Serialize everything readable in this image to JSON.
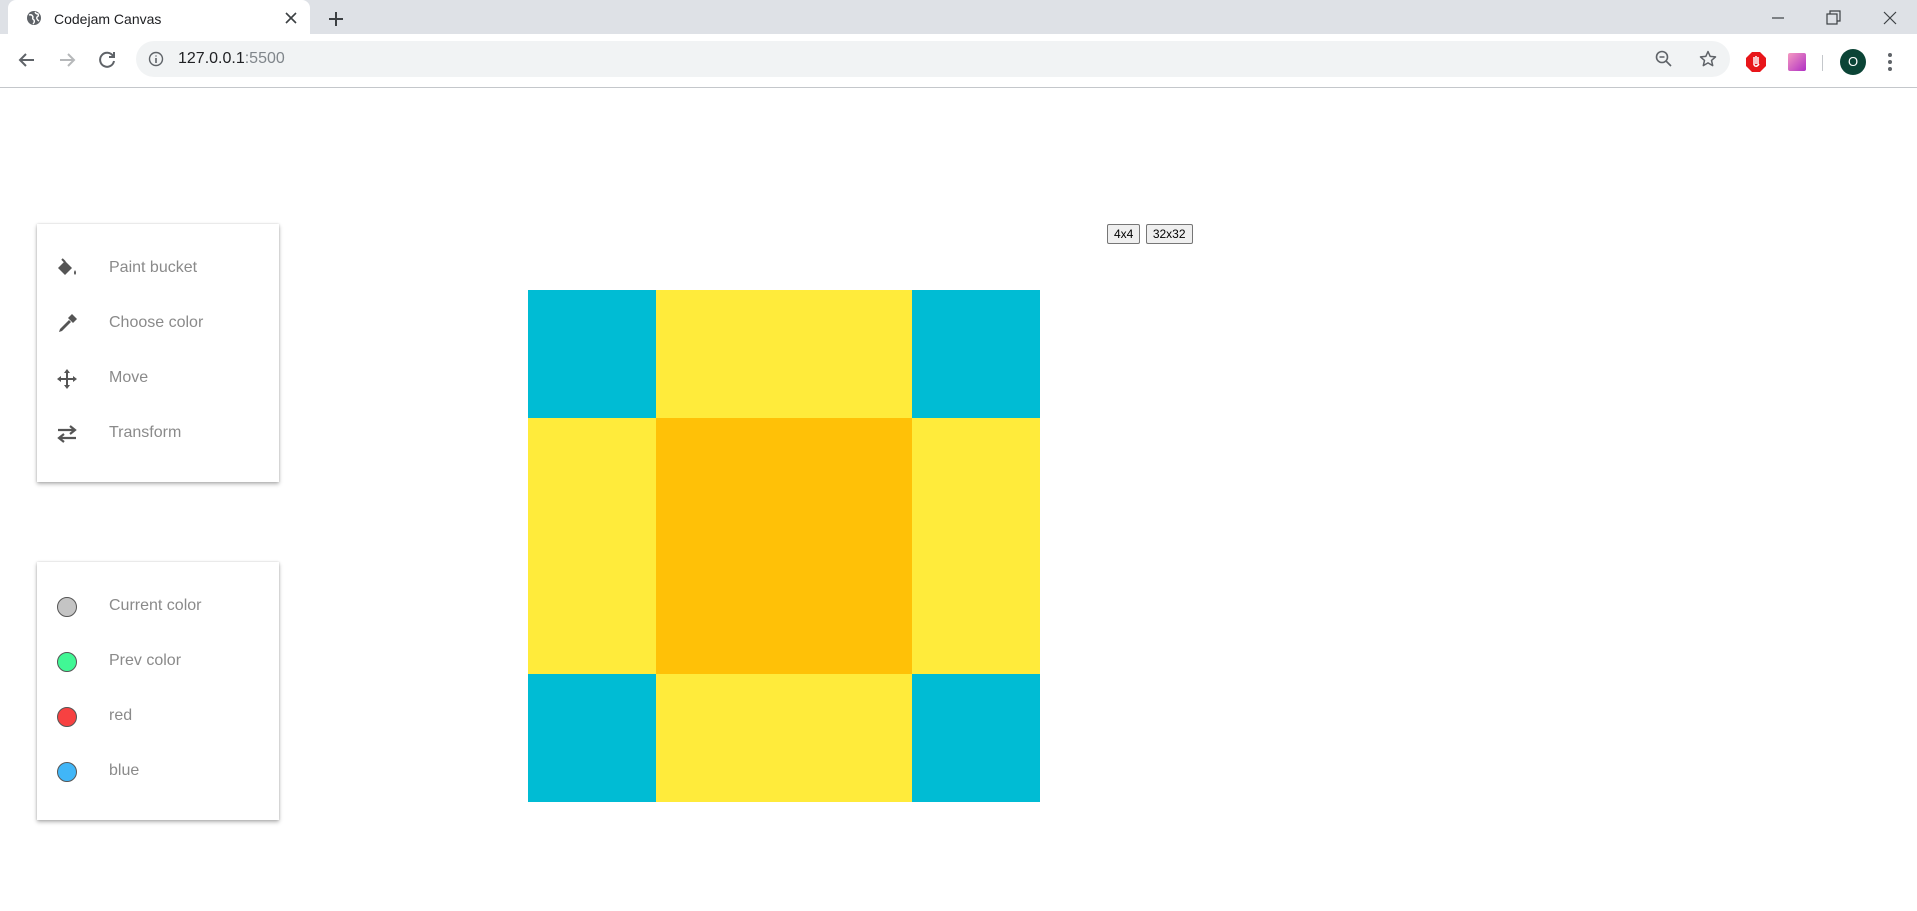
{
  "browser": {
    "tab_title": "Codejam Canvas",
    "url_host": "127.0.0.1",
    "url_port": ":5500",
    "profile_initial": "O"
  },
  "tools_panel": {
    "items": [
      {
        "label": "Paint bucket",
        "icon": "paint-bucket-icon"
      },
      {
        "label": "Choose color",
        "icon": "eyedropper-icon"
      },
      {
        "label": "Move",
        "icon": "move-icon"
      },
      {
        "label": "Transform",
        "icon": "swap-arrows-icon"
      }
    ]
  },
  "colors_panel": {
    "items": [
      {
        "label": "Current color",
        "color": "#c4c4c4"
      },
      {
        "label": "Prev color",
        "color": "#41f795"
      },
      {
        "label": "red",
        "color": "#f74141"
      },
      {
        "label": "blue",
        "color": "#41b6f7"
      }
    ]
  },
  "size_buttons": [
    "4x4",
    "32x32"
  ],
  "canvas": {
    "grid": 4,
    "colors": [
      [
        "#00bcd4",
        "#ffeb3b",
        "#ffeb3b",
        "#00bcd4"
      ],
      [
        "#ffeb3b",
        "#ffc107",
        "#ffc107",
        "#ffeb3b"
      ],
      [
        "#ffeb3b",
        "#ffc107",
        "#ffc107",
        "#ffeb3b"
      ],
      [
        "#00bcd4",
        "#ffeb3b",
        "#ffeb3b",
        "#00bcd4"
      ]
    ]
  }
}
